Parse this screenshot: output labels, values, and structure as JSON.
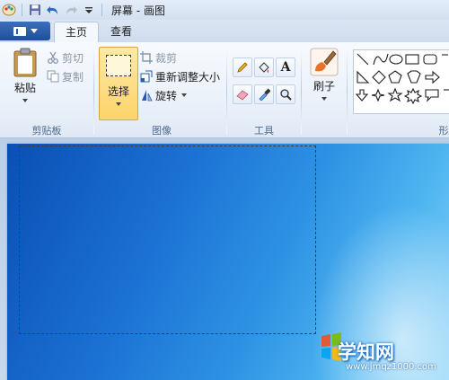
{
  "window": {
    "title": "屏幕 - 画图"
  },
  "tabs": [
    {
      "label": "主页"
    },
    {
      "label": "查看"
    }
  ],
  "clipboard": {
    "paste": "粘贴",
    "cut": "剪切",
    "copy": "复制",
    "group": "剪贴板"
  },
  "image": {
    "select": "选择",
    "crop": "裁剪",
    "resize": "重新调整大小",
    "rotate": "旋转",
    "group": "图像"
  },
  "tools": {
    "group": "工具",
    "text_glyph": "A"
  },
  "brushes": {
    "label": "刷子"
  },
  "shapes": {
    "group_partial": "形"
  },
  "watermark": {
    "brand": "学知网",
    "url": "www.jmqz1000.com"
  },
  "colors": {
    "accent": "#2a5ba6",
    "select_bg": "#fbd46a"
  }
}
